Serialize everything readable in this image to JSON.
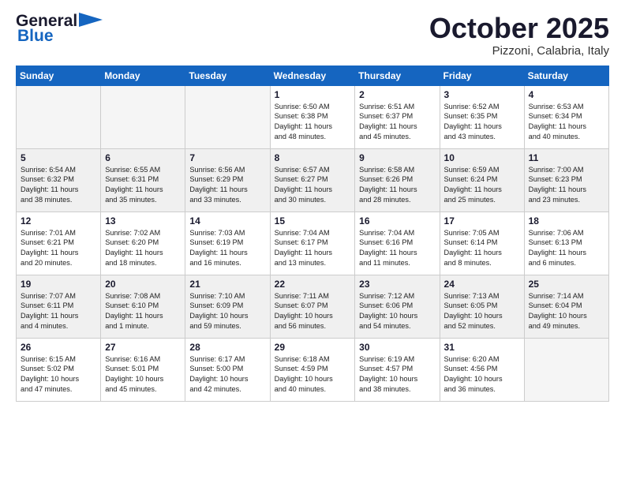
{
  "logo": {
    "line1": "General",
    "line2": "Blue"
  },
  "title": "October 2025",
  "subtitle": "Pizzoni, Calabria, Italy",
  "weekdays": [
    "Sunday",
    "Monday",
    "Tuesday",
    "Wednesday",
    "Thursday",
    "Friday",
    "Saturday"
  ],
  "weeks": [
    [
      {
        "day": "",
        "info": ""
      },
      {
        "day": "",
        "info": ""
      },
      {
        "day": "",
        "info": ""
      },
      {
        "day": "1",
        "info": "Sunrise: 6:50 AM\nSunset: 6:38 PM\nDaylight: 11 hours\nand 48 minutes."
      },
      {
        "day": "2",
        "info": "Sunrise: 6:51 AM\nSunset: 6:37 PM\nDaylight: 11 hours\nand 45 minutes."
      },
      {
        "day": "3",
        "info": "Sunrise: 6:52 AM\nSunset: 6:35 PM\nDaylight: 11 hours\nand 43 minutes."
      },
      {
        "day": "4",
        "info": "Sunrise: 6:53 AM\nSunset: 6:34 PM\nDaylight: 11 hours\nand 40 minutes."
      }
    ],
    [
      {
        "day": "5",
        "info": "Sunrise: 6:54 AM\nSunset: 6:32 PM\nDaylight: 11 hours\nand 38 minutes."
      },
      {
        "day": "6",
        "info": "Sunrise: 6:55 AM\nSunset: 6:31 PM\nDaylight: 11 hours\nand 35 minutes."
      },
      {
        "day": "7",
        "info": "Sunrise: 6:56 AM\nSunset: 6:29 PM\nDaylight: 11 hours\nand 33 minutes."
      },
      {
        "day": "8",
        "info": "Sunrise: 6:57 AM\nSunset: 6:27 PM\nDaylight: 11 hours\nand 30 minutes."
      },
      {
        "day": "9",
        "info": "Sunrise: 6:58 AM\nSunset: 6:26 PM\nDaylight: 11 hours\nand 28 minutes."
      },
      {
        "day": "10",
        "info": "Sunrise: 6:59 AM\nSunset: 6:24 PM\nDaylight: 11 hours\nand 25 minutes."
      },
      {
        "day": "11",
        "info": "Sunrise: 7:00 AM\nSunset: 6:23 PM\nDaylight: 11 hours\nand 23 minutes."
      }
    ],
    [
      {
        "day": "12",
        "info": "Sunrise: 7:01 AM\nSunset: 6:21 PM\nDaylight: 11 hours\nand 20 minutes."
      },
      {
        "day": "13",
        "info": "Sunrise: 7:02 AM\nSunset: 6:20 PM\nDaylight: 11 hours\nand 18 minutes."
      },
      {
        "day": "14",
        "info": "Sunrise: 7:03 AM\nSunset: 6:19 PM\nDaylight: 11 hours\nand 16 minutes."
      },
      {
        "day": "15",
        "info": "Sunrise: 7:04 AM\nSunset: 6:17 PM\nDaylight: 11 hours\nand 13 minutes."
      },
      {
        "day": "16",
        "info": "Sunrise: 7:04 AM\nSunset: 6:16 PM\nDaylight: 11 hours\nand 11 minutes."
      },
      {
        "day": "17",
        "info": "Sunrise: 7:05 AM\nSunset: 6:14 PM\nDaylight: 11 hours\nand 8 minutes."
      },
      {
        "day": "18",
        "info": "Sunrise: 7:06 AM\nSunset: 6:13 PM\nDaylight: 11 hours\nand 6 minutes."
      }
    ],
    [
      {
        "day": "19",
        "info": "Sunrise: 7:07 AM\nSunset: 6:11 PM\nDaylight: 11 hours\nand 4 minutes."
      },
      {
        "day": "20",
        "info": "Sunrise: 7:08 AM\nSunset: 6:10 PM\nDaylight: 11 hours\nand 1 minute."
      },
      {
        "day": "21",
        "info": "Sunrise: 7:10 AM\nSunset: 6:09 PM\nDaylight: 10 hours\nand 59 minutes."
      },
      {
        "day": "22",
        "info": "Sunrise: 7:11 AM\nSunset: 6:07 PM\nDaylight: 10 hours\nand 56 minutes."
      },
      {
        "day": "23",
        "info": "Sunrise: 7:12 AM\nSunset: 6:06 PM\nDaylight: 10 hours\nand 54 minutes."
      },
      {
        "day": "24",
        "info": "Sunrise: 7:13 AM\nSunset: 6:05 PM\nDaylight: 10 hours\nand 52 minutes."
      },
      {
        "day": "25",
        "info": "Sunrise: 7:14 AM\nSunset: 6:04 PM\nDaylight: 10 hours\nand 49 minutes."
      }
    ],
    [
      {
        "day": "26",
        "info": "Sunrise: 6:15 AM\nSunset: 5:02 PM\nDaylight: 10 hours\nand 47 minutes."
      },
      {
        "day": "27",
        "info": "Sunrise: 6:16 AM\nSunset: 5:01 PM\nDaylight: 10 hours\nand 45 minutes."
      },
      {
        "day": "28",
        "info": "Sunrise: 6:17 AM\nSunset: 5:00 PM\nDaylight: 10 hours\nand 42 minutes."
      },
      {
        "day": "29",
        "info": "Sunrise: 6:18 AM\nSunset: 4:59 PM\nDaylight: 10 hours\nand 40 minutes."
      },
      {
        "day": "30",
        "info": "Sunrise: 6:19 AM\nSunset: 4:57 PM\nDaylight: 10 hours\nand 38 minutes."
      },
      {
        "day": "31",
        "info": "Sunrise: 6:20 AM\nSunset: 4:56 PM\nDaylight: 10 hours\nand 36 minutes."
      },
      {
        "day": "",
        "info": ""
      }
    ]
  ]
}
